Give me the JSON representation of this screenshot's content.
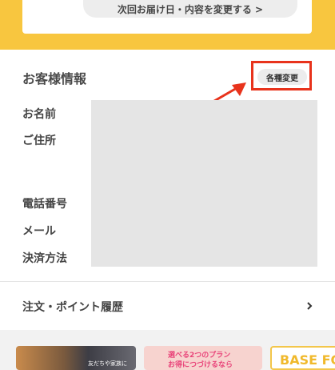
{
  "top": {
    "change_delivery_label": "次回お届け日・内容を変更する >"
  },
  "customer_info": {
    "title": "お客様情報",
    "edit_label": "各種変更",
    "fields": [
      "お名前",
      "ご住所",
      "電話番号",
      "メール",
      "決済方法"
    ]
  },
  "history": {
    "label": "注文・ポイント履歴"
  },
  "banners": {
    "banner1_text": "友だちや家族に",
    "banner2_line1": "選べる2つのプラン",
    "banner2_line2": "お得につづけるなら",
    "banner3_text": "BASE FOOD"
  },
  "colors": {
    "brand_yellow": "#f8c63f",
    "highlight_red": "#e8331c"
  }
}
